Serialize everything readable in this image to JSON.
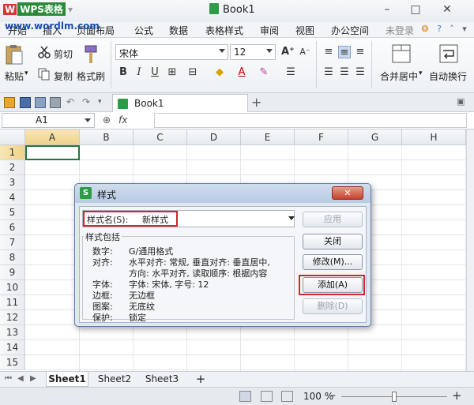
{
  "title_bar": {
    "logo_w": "W",
    "logo_text": "WPS表格",
    "doc_title": "Book1",
    "watermark": "www.wordlm.com"
  },
  "window_controls": {
    "min": "–",
    "max": "□",
    "close": "✕"
  },
  "menu": {
    "items": [
      "开始",
      "插入",
      "页面布局",
      "公式",
      "数据",
      "表格样式",
      "审阅",
      "视图",
      "办公空间"
    ],
    "login": "未登录"
  },
  "ribbon": {
    "paste": "粘贴",
    "cut": "剪切",
    "copy": "复制",
    "format_painter": "格式刷",
    "font_name": "宋体",
    "font_size": "12",
    "merge_center": "合并居中",
    "auto_wrap": "自动换行"
  },
  "tab_bar": {
    "book_tab": "Book1",
    "add": "+"
  },
  "formula_bar": {
    "cell_ref": "A1",
    "fx": "fx"
  },
  "grid": {
    "columns": [
      "A",
      "B",
      "C",
      "D",
      "E",
      "F",
      "G",
      "H"
    ],
    "rows": [
      "1",
      "2",
      "3",
      "4",
      "5",
      "6",
      "7",
      "8",
      "9",
      "10",
      "11",
      "12",
      "13",
      "14",
      "15"
    ]
  },
  "sheet_tabs": {
    "tabs": [
      "Sheet1",
      "Sheet2",
      "Sheet3"
    ],
    "add": "+"
  },
  "status": {
    "zoom": "100 %",
    "minus": "–",
    "plus": "+",
    "zoom_level": 0.5
  },
  "dialog": {
    "title": "样式",
    "close": "✕",
    "style_name_label": "样式名(S):",
    "style_name_value": "新样式",
    "group_label": "样式包括",
    "props": [
      {
        "label": "数字:",
        "value": "G/通用格式"
      },
      {
        "label": "对齐:",
        "value": "水平对齐: 常规, 垂直对齐: 垂直居中,"
      },
      {
        "label": "",
        "value": "方向: 水平对齐, 读取顺序: 根据内容"
      },
      {
        "label": "字体:",
        "value": "字体: 宋体, 字号: 12"
      },
      {
        "label": "边框:",
        "value": "无边框"
      },
      {
        "label": "图案:",
        "value": "无底纹"
      },
      {
        "label": "保护:",
        "value": "锁定"
      }
    ],
    "buttons": {
      "apply": "应用",
      "close": "关闭",
      "modify": "修改(M)...",
      "add": "添加(A)",
      "delete": "删除(D)"
    }
  }
}
